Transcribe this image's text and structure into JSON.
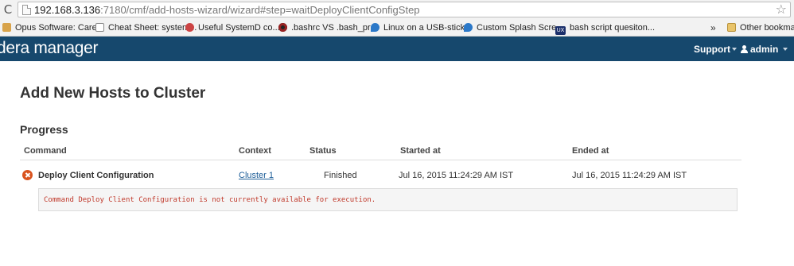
{
  "browser": {
    "url_host": "192.168.3.136",
    "url_path": ":7180/cmf/add-hosts-wizard/wizard#step=waitDeployClientConfigStep",
    "bookmarks": [
      {
        "label": "Opus Software: Care...",
        "icon": "opus-icon"
      },
      {
        "label": "Cheat Sheet: system...",
        "icon": "document-icon"
      },
      {
        "label": "Useful SystemD co...",
        "icon": "red-leaf-icon"
      },
      {
        "label": ".bashrc VS .bash_pr...",
        "icon": "dark-circle-icon"
      },
      {
        "label": "Linux on a USB-stick...",
        "icon": "drupal-icon"
      },
      {
        "label": "Custom Splash Scre...",
        "icon": "drupal-icon"
      },
      {
        "label": "bash script quesiton...",
        "icon": "ux-icon"
      }
    ],
    "overflow": "»",
    "other_bookmarks": "Other bookmark"
  },
  "nav": {
    "brand": "dera manager",
    "support": "Support",
    "user": "admin"
  },
  "page": {
    "title": "Add New Hosts to Cluster",
    "section": "Progress",
    "columns": {
      "command": "Command",
      "context": "Context",
      "status": "Status",
      "started": "Started at",
      "ended": "Ended at"
    },
    "row": {
      "command": "Deploy Client Configuration",
      "context": "Cluster 1",
      "status": "Finished",
      "started": "Jul 16, 2015 11:24:29 AM IST",
      "ended": "Jul 16, 2015 11:24:29 AM IST",
      "message": "Command Deploy Client Configuration is not currently available for execution."
    }
  },
  "colors": {
    "navbar": "#16486d",
    "error": "#d9531e",
    "link": "#1f5f99"
  }
}
